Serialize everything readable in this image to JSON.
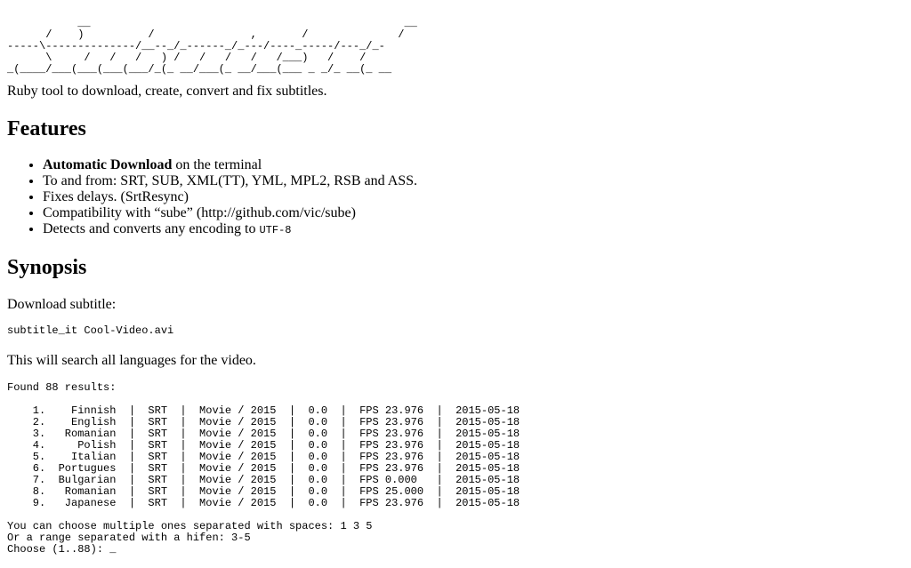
{
  "banner": {
    "ascii_lines": [
      "           __                                                 __",
      "      /    )          /               ,       /              /",
      "-----\\--------------/__--_/_------_/_---/----_-----/---_/_-",
      "      \\     /   /   /   ) /   /   /   /   /___)   /    /",
      "_(____/___(___(___(___/_(_ __/___(_ __/___(___ _ _/_ __(_ __"
    ]
  },
  "intro": "Ruby tool to download, create, convert and fix subtitles.",
  "features": {
    "heading": "Features",
    "items": [
      {
        "strong": "Automatic Download",
        "text": " on the terminal",
        "code": ""
      },
      {
        "strong": "",
        "text": "To and from: SRT, SUB, XML(TT), YML, MPL2, RSB and ASS.",
        "code": ""
      },
      {
        "strong": "",
        "text": "Fixes delays. (SrtResync)",
        "code": ""
      },
      {
        "strong": "",
        "text": "Compatibility with “sube” (http://github.com/vic/sube)",
        "code": ""
      },
      {
        "strong": "",
        "text": "Detects and converts any encoding to ",
        "code": "UTF-8"
      }
    ]
  },
  "synopsis": {
    "heading": "Synopsis",
    "download_label": "Download subtitle:",
    "command": "subtitle_it Cool-Video.avi",
    "search_note": "This will search all languages for the video.",
    "results_output": [
      "Found 88 results:",
      "",
      "    1.    Finnish  |  SRT  |  Movie / 2015  |  0.0  |  FPS 23.976  |  2015-05-18",
      "    2.    English  |  SRT  |  Movie / 2015  |  0.0  |  FPS 23.976  |  2015-05-18",
      "    3.   Romanian  |  SRT  |  Movie / 2015  |  0.0  |  FPS 23.976  |  2015-05-18",
      "    4.     Polish  |  SRT  |  Movie / 2015  |  0.0  |  FPS 23.976  |  2015-05-18",
      "    5.    Italian  |  SRT  |  Movie / 2015  |  0.0  |  FPS 23.976  |  2015-05-18",
      "    6.  Portugues  |  SRT  |  Movie / 2015  |  0.0  |  FPS 23.976  |  2015-05-18",
      "    7.  Bulgarian  |  SRT  |  Movie / 2015  |  0.0  |  FPS 0.000   |  2015-05-18",
      "    8.   Romanian  |  SRT  |  Movie / 2015  |  0.0  |  FPS 25.000  |  2015-05-18",
      "    9.   Japanese  |  SRT  |  Movie / 2015  |  0.0  |  FPS 23.976  |  2015-05-18",
      "",
      "You can choose multiple ones separated with spaces: 1 3 5",
      "Or a range separated with a hifen: 3-5",
      "Choose (1..88): _"
    ]
  }
}
